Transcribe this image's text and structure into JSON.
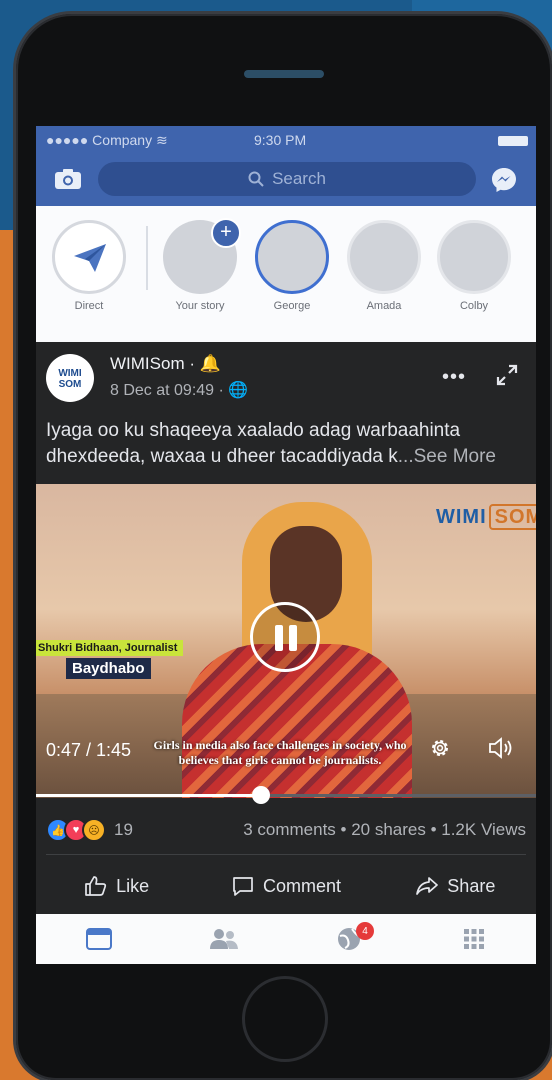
{
  "status_bar": {
    "carrier": "●●●●● Company ≋",
    "time": "9:30 PM"
  },
  "search": {
    "placeholder": "Search"
  },
  "stories": [
    {
      "label": "Direct"
    },
    {
      "label": "Your story"
    },
    {
      "label": "George"
    },
    {
      "label": "Amada"
    },
    {
      "label": "Colby"
    }
  ],
  "post": {
    "author": "WIMISom · 🔔",
    "avatar_text": "WIMI SOM",
    "meta": "8 Dec at 09:49 · 🌐",
    "text": "Iyaga oo ku shaqeeya xaalado adag warbaahinta dhexdeeda, waxaa u dheer tacaddiyada k",
    "see_more": "...See More",
    "video": {
      "watermark_1": "WIMI",
      "watermark_2": "SOM",
      "name_tag": "Shukri Bidhaan, Journalist",
      "place_tag": "Baydhabo",
      "time": "0:47 / 1:45",
      "subtitle": "Girls in media also face challenges in society, who believes that girls cannot be journalists.",
      "progress_fraction": 0.45
    },
    "reaction_count": "19",
    "stats": "3 comments • 20 shares • 1.2K Views",
    "actions": {
      "like": "Like",
      "comment": "Comment",
      "share": "Share"
    }
  },
  "bottom_nav": {
    "badge": "4"
  },
  "colors": {
    "facebook_blue": "#3f64ad",
    "post_bg": "#242526",
    "accent_orange": "#d9792e"
  }
}
